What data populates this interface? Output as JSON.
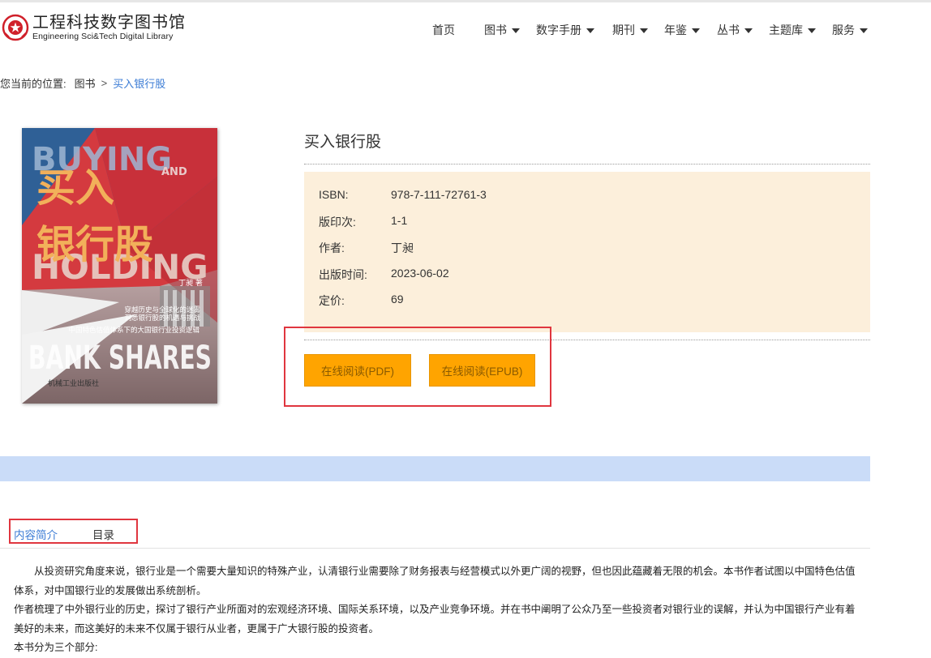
{
  "header": {
    "logo_cn": "工程科技数字图书馆",
    "logo_en": "Engineering Sci&Tech Digital Library",
    "nav": [
      {
        "label": "首页",
        "has_menu": false
      },
      {
        "label": "图书",
        "has_menu": true
      },
      {
        "label": "数字手册",
        "has_menu": true
      },
      {
        "label": "期刊",
        "has_menu": true
      },
      {
        "label": "年鉴",
        "has_menu": true
      },
      {
        "label": "丛书",
        "has_menu": true
      },
      {
        "label": "主题库",
        "has_menu": true
      },
      {
        "label": "服务",
        "has_menu": true
      }
    ]
  },
  "breadcrumb": {
    "prefix": "您当前的位置:",
    "items": [
      "图书",
      "买入银行股"
    ],
    "separator": ">"
  },
  "cover": {
    "title_en_top": "BUYING",
    "title_en_and": "AND",
    "title_en_mid": "HOLDING",
    "title_en_bottom": "BANK SHARES",
    "title_cn_1": "买入",
    "title_cn_2": "银行股",
    "author": "丁昶 著",
    "tagline_1": "穿越历史与全球化的迷雾",
    "tagline_2": "洞悉银行股的机遇与挑战",
    "tagline_3": "中国特色估值体系下的大国银行业投资逻辑",
    "publisher": "机械工业出版社"
  },
  "book": {
    "title": "买入银行股",
    "fields": [
      {
        "label": "ISBN:",
        "value": "978-7-111-72761-3"
      },
      {
        "label": "版印次:",
        "value": "1-1"
      },
      {
        "label": "作者:",
        "value": "丁昶"
      },
      {
        "label": "出版时间:",
        "value": "2023-06-02"
      },
      {
        "label": "定价:",
        "value": "69"
      }
    ]
  },
  "actions": {
    "read_pdf": "在线阅读(PDF)",
    "read_epub": "在线阅读(EPUB)"
  },
  "tabs": [
    "内容简介",
    "目录"
  ],
  "description": [
    "从投资研究角度来说，银行业是一个需要大量知识的特殊产业，认清银行业需要除了财务报表与经营模式以外更广阔的视野，但也因此蕴藏着无限的机会。本书作者试图以中国特色估值体系，对中国银行业的发展做出系统剖析。",
    "作者梳理了中外银行业的历史，探讨了银行产业所面对的宏观经济环境、国际关系环境，以及产业竞争环境。并在书中阐明了公众乃至一些投资者对银行业的误解，并认为中国银行产业有着美好的未来，而这美好的未来不仅属于银行从业者，更属于广大银行股的投资者。",
    "本书分为三个部分:"
  ],
  "colors": {
    "accent_blue": "#3a7bd5",
    "button_orange": "#ffa400",
    "info_bg": "#fcefdb",
    "band_blue": "#cadcf8",
    "highlight_red": "#e0363f"
  }
}
